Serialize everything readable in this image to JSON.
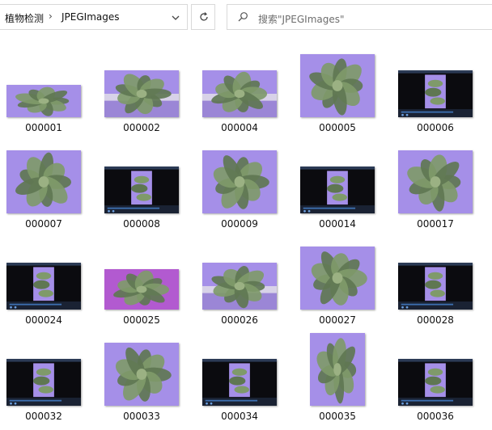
{
  "breadcrumb": {
    "parent": "植物检测",
    "current": "JPEGImages"
  },
  "search": {
    "placeholder": "搜索\"JPEGImages\""
  },
  "files": [
    {
      "name": "000001",
      "kind": "plant_wide"
    },
    {
      "name": "000002",
      "kind": "plant_tray"
    },
    {
      "name": "000004",
      "kind": "plant_tray"
    },
    {
      "name": "000005",
      "kind": "plant"
    },
    {
      "name": "000006",
      "kind": "player"
    },
    {
      "name": "000007",
      "kind": "plant"
    },
    {
      "name": "000008",
      "kind": "player"
    },
    {
      "name": "000009",
      "kind": "plant"
    },
    {
      "name": "000014",
      "kind": "player"
    },
    {
      "name": "000017",
      "kind": "plant"
    },
    {
      "name": "000024",
      "kind": "player"
    },
    {
      "name": "000025",
      "kind": "plant_magenta"
    },
    {
      "name": "000026",
      "kind": "plant_tray"
    },
    {
      "name": "000027",
      "kind": "plant"
    },
    {
      "name": "000028",
      "kind": "player"
    },
    {
      "name": "000032",
      "kind": "player"
    },
    {
      "name": "000033",
      "kind": "plant"
    },
    {
      "name": "000034",
      "kind": "player"
    },
    {
      "name": "000035",
      "kind": "plant_portrait"
    },
    {
      "name": "000036",
      "kind": "player"
    }
  ],
  "colors": {
    "purple": "#a58fe8",
    "leaf": "#7f9a6a",
    "leaf_dark": "#5f7752",
    "player_bg": "#0b0b0f"
  }
}
